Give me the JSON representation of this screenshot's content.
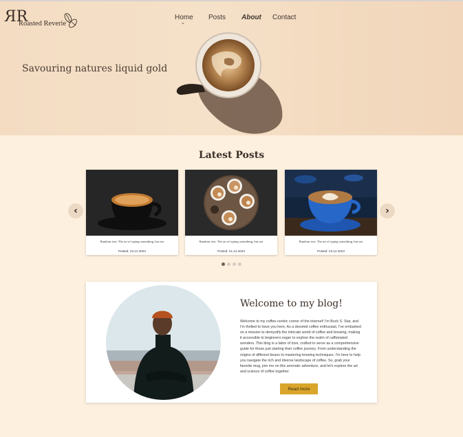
{
  "brand": {
    "monogram": "RR",
    "name": "Roasted Reverie"
  },
  "nav": {
    "home": "Home",
    "posts": "Posts",
    "about": "About",
    "contact": "Contact"
  },
  "hero": {
    "tagline": "Savouring natures liquid gold"
  },
  "latest": {
    "title": "Latest Posts",
    "prev_icon": "chevron-left-icon",
    "next_icon": "chevron-right-icon",
    "posts": [
      {
        "caption": "Random text: The art of typing something, but not",
        "date": "Posted: 23.12.2023"
      },
      {
        "caption": "Random text: The art of typing something, but not",
        "date": "Posted: 21.12.2023"
      },
      {
        "caption": "Random text: The art of typing something, but not",
        "date": "Posted: 23.12.2023"
      }
    ],
    "active_page": 1,
    "page_count": 4
  },
  "welcome": {
    "title": "Welcome to my blog!",
    "body": "Welcome to my coffee-centric corner of the internet! I'm Buck S. Star, and I'm thrilled to have you here. As a devoted coffee enthusiast, I've embarked on a mission to demystify the intricate world of coffee and brewing, making it accessible to beginners eager to explore the realm of caffeinated wonders. This blog is a labor of love, crafted to serve as a comprehensive guide for those just starting their coffee journey. From understanding the origins of different beans to mastering brewing techniques, I'm here to help you navigate the rich and diverse landscape of coffee. So, grab your favorite mug, join me on this aromatic adventure, and let's explore the art and science of coffee together.",
    "button": "Read more"
  },
  "colors": {
    "accent": "#d9a52b",
    "background": "#fdf0df",
    "text": "#3b2f28"
  }
}
